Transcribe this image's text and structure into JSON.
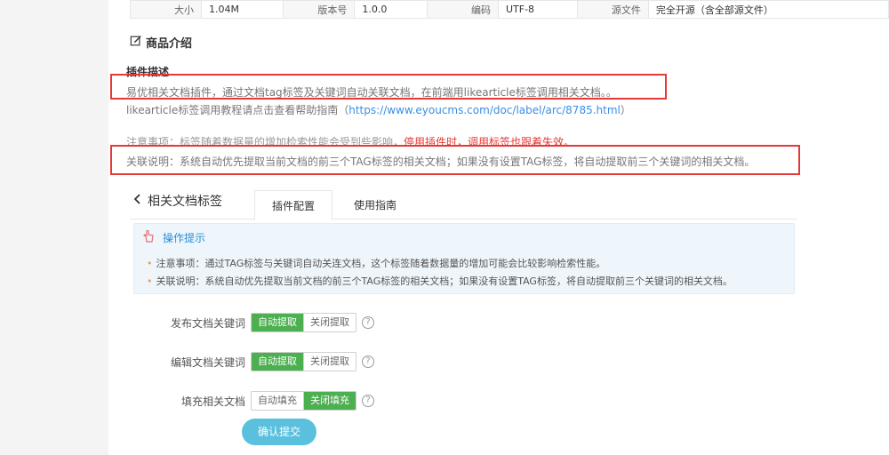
{
  "spec": {
    "size_label": "大小",
    "size_value": "1.04M",
    "version_label": "版本号",
    "version_value": "1.0.0",
    "encoding_label": "编码",
    "encoding_value": "UTF-8",
    "source_label": "源文件",
    "source_value": "完全开源（含全部源文件）"
  },
  "intro": {
    "title": "商品介绍",
    "desc_heading": "插件描述",
    "desc_body": "易优相关文档插件，通过文档tag标签及关键词自动关联文档，在前端用likearticle标签调用相关文档。。",
    "help_prefix": "likearticle标签调用教程请点击查看帮助指南（",
    "help_link": "https://www.eyoucms.com/doc/label/arc/8785.html",
    "help_suffix": "）",
    "notice_prefix": "注意事项：标签随着数据量的增加检索性能会受到些影响，",
    "notice_warn": "停用插件时，调用标签也跟着失效。",
    "relation": "关联说明：系统自动优先提取当前文档的前三个TAG标签的相关文档；如果没有设置TAG标签，将自动提取前三个关键词的相关文档。"
  },
  "tabs": {
    "back_label": "相关文档标签",
    "config_label": "插件配置",
    "guide_label": "使用指南"
  },
  "tips": {
    "title": "操作提示",
    "items": [
      "注意事项：通过TAG标签与关键词自动关连文档，这个标签随着数据量的增加可能会比较影响检索性能。",
      "关联说明：系统自动优先提取当前文档的前三个TAG标签的相关文档；如果没有设置TAG标签，将自动提取前三个关键词的相关文档。"
    ]
  },
  "form": {
    "publish_keywords": {
      "label": "发布文档关键词",
      "on": "自动提取",
      "off": "关闭提取",
      "selected": "on"
    },
    "edit_keywords": {
      "label": "编辑文档关键词",
      "on": "自动提取",
      "off": "关闭提取",
      "selected": "on"
    },
    "fill_related": {
      "label": "填充相关文档",
      "on": "自动填充",
      "off": "关闭填充",
      "selected": "off"
    },
    "help_glyph": "?",
    "submit_label": "确认提交"
  },
  "colors": {
    "accent_green": "#4caf50",
    "link_blue": "#3a8ee6",
    "warn_red": "#e53935",
    "submit_bg": "#5bc0de"
  }
}
